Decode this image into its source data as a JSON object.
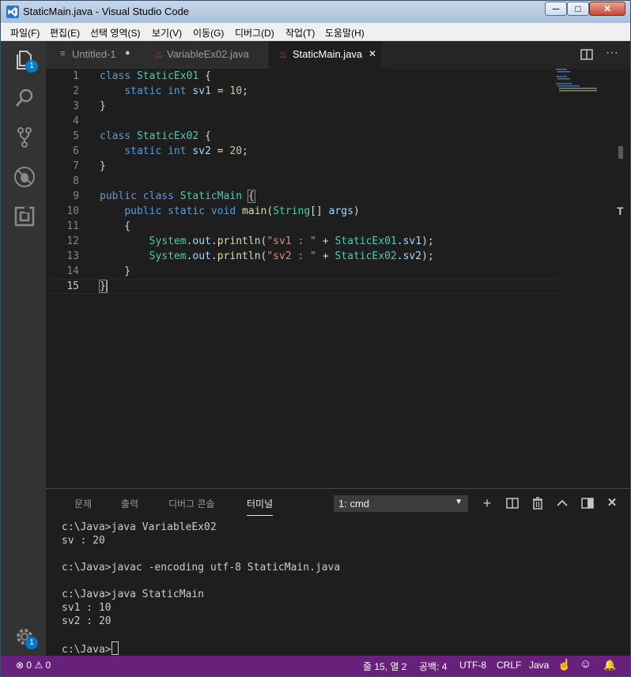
{
  "window": {
    "title": "StaticMain.java - Visual Studio Code",
    "min_label": "─",
    "max_label": "□",
    "close_label": "✕"
  },
  "menu": [
    "파일(F)",
    "편집(E)",
    "선택 영역(S)",
    "보기(V)",
    "이동(G)",
    "디버그(D)",
    "작업(T)",
    "도움말(H)"
  ],
  "activity": {
    "explorer_badge": "1",
    "settings_badge": "1",
    "icons": [
      "files-icon",
      "search-icon",
      "source-control-icon",
      "debug-icon",
      "extensions-icon",
      "gear-icon"
    ]
  },
  "tabs": [
    {
      "label": "Untitled-1",
      "dirty_marker": "●"
    },
    {
      "label": "VariableEx02.java"
    },
    {
      "label": "StaticMain.java",
      "close": "✕"
    }
  ],
  "editor": {
    "current_line": "15",
    "lines": [
      {
        "n": "1",
        "text": "class StaticEx01 {"
      },
      {
        "n": "2",
        "text": "    static int sv1 = 10;"
      },
      {
        "n": "3",
        "text": "}"
      },
      {
        "n": "4",
        "text": ""
      },
      {
        "n": "5",
        "text": "class StaticEx02 {"
      },
      {
        "n": "6",
        "text": "    static int sv2 = 20;"
      },
      {
        "n": "7",
        "text": "}"
      },
      {
        "n": "8",
        "text": ""
      },
      {
        "n": "9",
        "text": "public class StaticMain {"
      },
      {
        "n": "10",
        "text": "    public static void main(String[] args)"
      },
      {
        "n": "11",
        "text": "    {"
      },
      {
        "n": "12",
        "text": "        System.out.println(\"sv1 : \" + StaticEx01.sv1);"
      },
      {
        "n": "13",
        "text": "        System.out.println(\"sv2 : \" + StaticEx02.sv2);"
      },
      {
        "n": "14",
        "text": "    }"
      },
      {
        "n": "15",
        "text": "}"
      }
    ]
  },
  "panel": {
    "tabs": [
      "문제",
      "출력",
      "디버그 콘솔",
      "터미널"
    ],
    "active_tab": "터미널",
    "terminal_select": "1: cmd",
    "terminal_lines": [
      "c:\\Java>java VariableEx02",
      "sv : 20",
      "",
      "c:\\Java>javac -encoding utf-8 StaticMain.java",
      "",
      "c:\\Java>java StaticMain",
      "sv1 : 10",
      "sv2 : 20",
      "",
      "c:\\Java>"
    ]
  },
  "status": {
    "errors": "0",
    "warnings": "0",
    "position": "줄 15, 열 2",
    "spaces": "공백: 4",
    "encoding": "UTF-8",
    "eol": "CRLF",
    "language": "Java"
  },
  "colors": {
    "statusbar": "#68217a",
    "accent": "#007acc",
    "editor_bg": "#1e1e1e"
  }
}
